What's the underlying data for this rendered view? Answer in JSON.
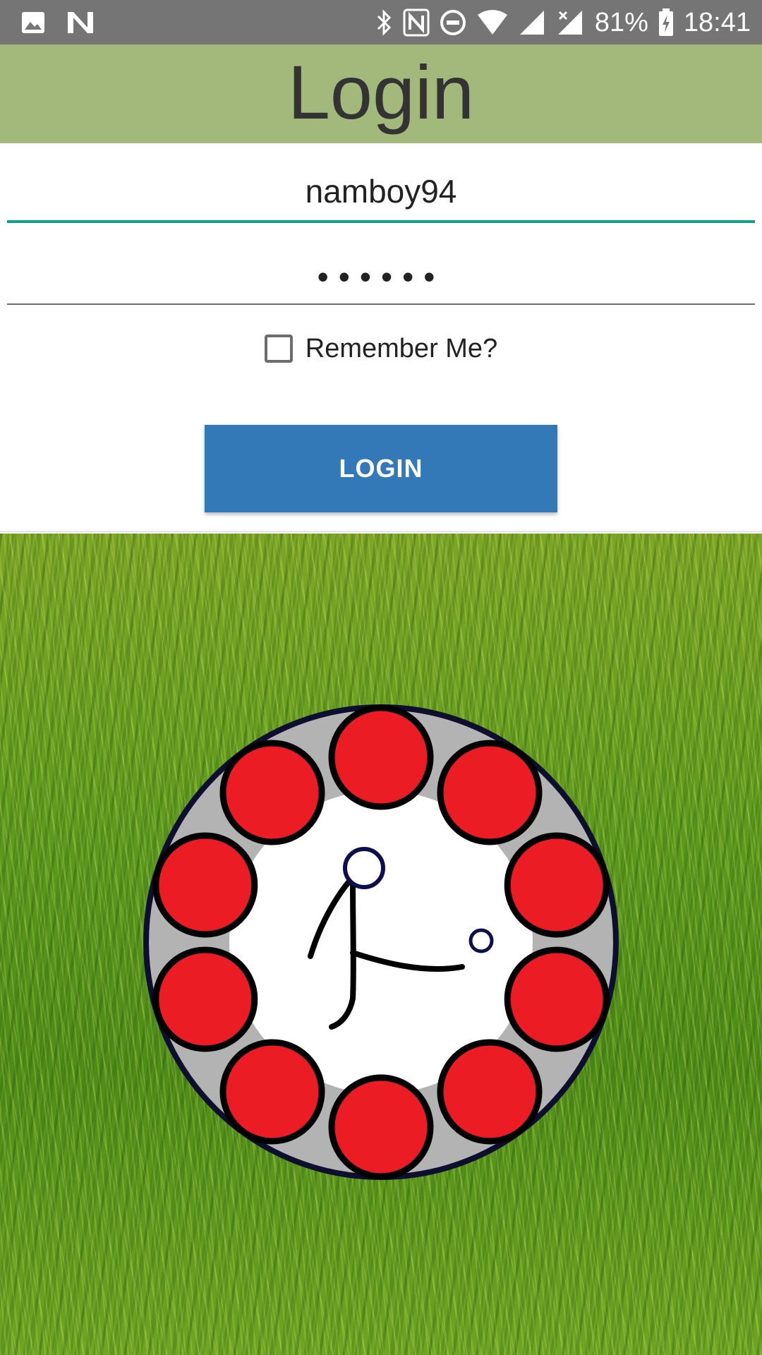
{
  "status_bar": {
    "icons_left": [
      "image-icon",
      "n-logo-icon"
    ],
    "icons_right": [
      "bluetooth-icon",
      "nfc-icon",
      "do-not-disturb-icon",
      "wifi-icon",
      "signal-icon",
      "signal-no-sim-icon"
    ],
    "battery_percent": "81%",
    "time": "18:41"
  },
  "toolbar": {
    "title": "Login"
  },
  "form": {
    "username_value": "namboy94",
    "password_masked": "••••••",
    "remember_label": "Remember Me?",
    "remember_checked": false,
    "login_button_label": "LOGIN"
  },
  "colors": {
    "status_bar": "#757575",
    "toolbar": "#a3b97b",
    "username_underline": "#12a08a",
    "login_button": "#3479b7",
    "logo_dots": "#ec1c24",
    "logo_ring": "#b3b3b3"
  },
  "background": {
    "image": "grass-field"
  }
}
